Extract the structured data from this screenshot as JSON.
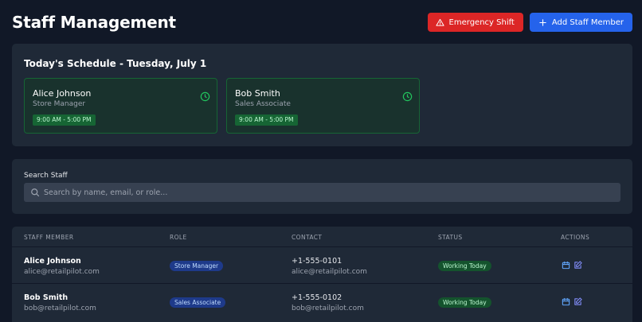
{
  "header": {
    "title": "Staff Management",
    "emergency_label": "Emergency Shift",
    "add_label": "Add Staff Member"
  },
  "schedule": {
    "title": "Today's Schedule - Tuesday, July 1",
    "shifts": [
      {
        "name": "Alice Johnson",
        "role": "Store Manager",
        "time": "9:00 AM - 5:00 PM"
      },
      {
        "name": "Bob Smith",
        "role": "Sales Associate",
        "time": "9:00 AM - 5:00 PM"
      }
    ]
  },
  "search": {
    "label": "Search Staff",
    "placeholder": "Search by name, email, or role..."
  },
  "table": {
    "columns": [
      "STAFF MEMBER",
      "ROLE",
      "CONTACT",
      "STATUS",
      "ACTIONS"
    ],
    "rows": [
      {
        "name": "Alice Johnson",
        "email": "alice@retailpilot.com",
        "role": "Store Manager",
        "phone": "+1-555-0101",
        "contact_email": "alice@retailpilot.com",
        "status": "Working Today"
      },
      {
        "name": "Bob Smith",
        "email": "bob@retailpilot.com",
        "role": "Sales Associate",
        "phone": "+1-555-0102",
        "contact_email": "bob@retailpilot.com",
        "status": "Working Today"
      }
    ]
  },
  "colors": {
    "emergency": "#dc2626",
    "primary": "#2563eb",
    "success": "#22c55e",
    "info": "#3b82f6"
  },
  "icons": {
    "emergency": "warning-triangle-icon",
    "add": "plus-icon",
    "shift": "clock-icon",
    "search": "search-icon",
    "schedule_action": "calendar-icon",
    "edit_action": "edit-icon"
  }
}
